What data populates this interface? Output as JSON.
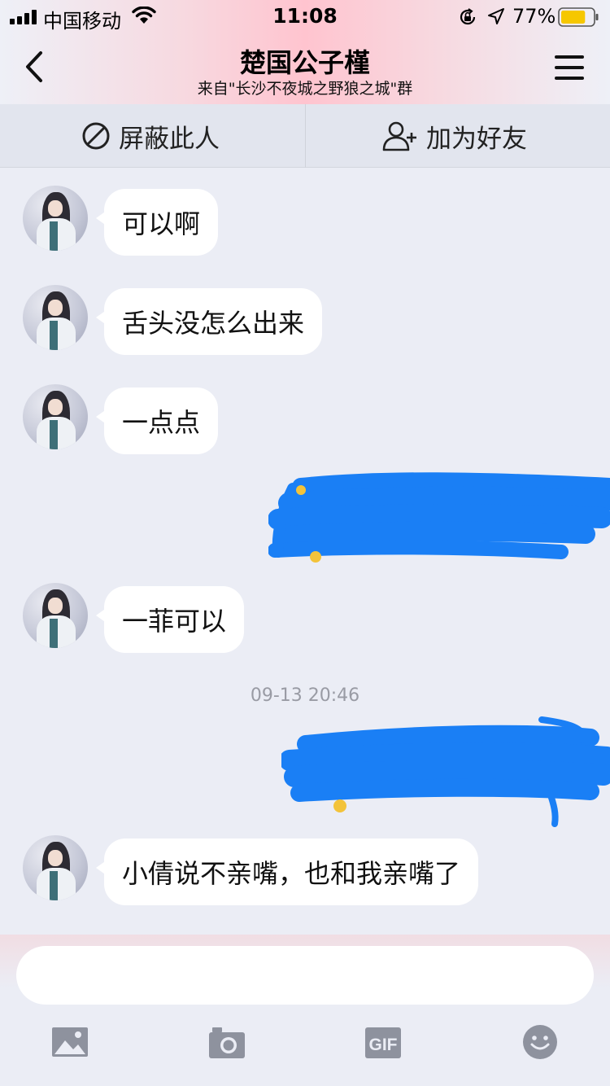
{
  "status_bar": {
    "carrier": "中国移动",
    "time": "11:08",
    "battery_percent": "77%",
    "battery_level": 0.77,
    "icons": [
      "signal-icon",
      "wifi-icon",
      "rotation-lock-icon",
      "location-icon",
      "battery-icon"
    ]
  },
  "nav": {
    "title": "楚国公子槿",
    "subtitle": "来自\"长沙不夜城之野狼之城\"群",
    "icons": [
      "back-icon",
      "menu-icon"
    ]
  },
  "actions": {
    "block_label": "屏蔽此人",
    "add_friend_label": "加为好友",
    "icons": [
      "block-icon",
      "add-friend-icon"
    ]
  },
  "messages": [
    {
      "sender": "other",
      "text": "可以啊"
    },
    {
      "sender": "other",
      "text": "舌头没怎么出来"
    },
    {
      "sender": "other",
      "text": "一点点"
    },
    {
      "sender": "self",
      "redacted": true
    },
    {
      "sender": "other",
      "text": "一菲可以"
    },
    {
      "sender": "self",
      "redacted": true
    },
    {
      "sender": "other",
      "text": "小倩说不亲嘴，也和我亲嘴了"
    }
  ],
  "timestamp": "09-13 20:46",
  "input": {
    "placeholder": ""
  },
  "toolbar": {
    "gif_label": "GIF",
    "icons": [
      "image-icon",
      "camera-icon",
      "gif-icon",
      "emoji-icon"
    ]
  },
  "colors": {
    "header_accent": "#ffc4cf",
    "chat_background": "#ebedf5",
    "bubble": "#ffffff",
    "redaction_scribble": "#1a7ff5",
    "toolbar_icon": "#8e929e"
  }
}
